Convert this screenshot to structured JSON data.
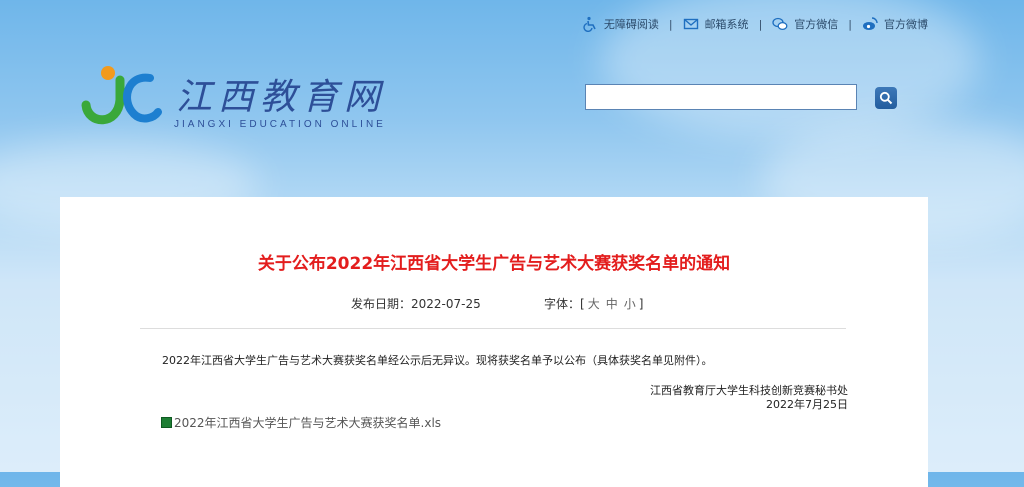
{
  "topbar": {
    "accessibility": "无障碍阅读",
    "mail": "邮箱系统",
    "wechat": "官方微信",
    "weibo": "官方微博",
    "separator": "|"
  },
  "logo": {
    "title": "江西教育网",
    "subtitle": "JIANGXI EDUCATION ONLINE"
  },
  "search": {
    "value": "",
    "placeholder": ""
  },
  "article": {
    "title": "关于公布2022年江西省大学生广告与艺术大赛获奖名单的通知",
    "date_label": "发布日期：2022-07-25",
    "font_label": "字体：[",
    "font_large": "大",
    "font_medium": "中",
    "font_small": "小",
    "font_close": "]",
    "body": "2022年江西省大学生广告与艺术大赛获奖名单经公示后无异议。现将获奖名单予以公布（具体获奖名单见附件）。",
    "signature_org": "江西省教育厅大学生科技创新竞赛秘书处",
    "signature_date": "2022年7月25日",
    "attachment": "2022年江西省大学生广告与艺术大赛获奖名单.xls"
  },
  "colors": {
    "title_red": "#e31d1d",
    "brand_blue": "#2d4f98"
  }
}
